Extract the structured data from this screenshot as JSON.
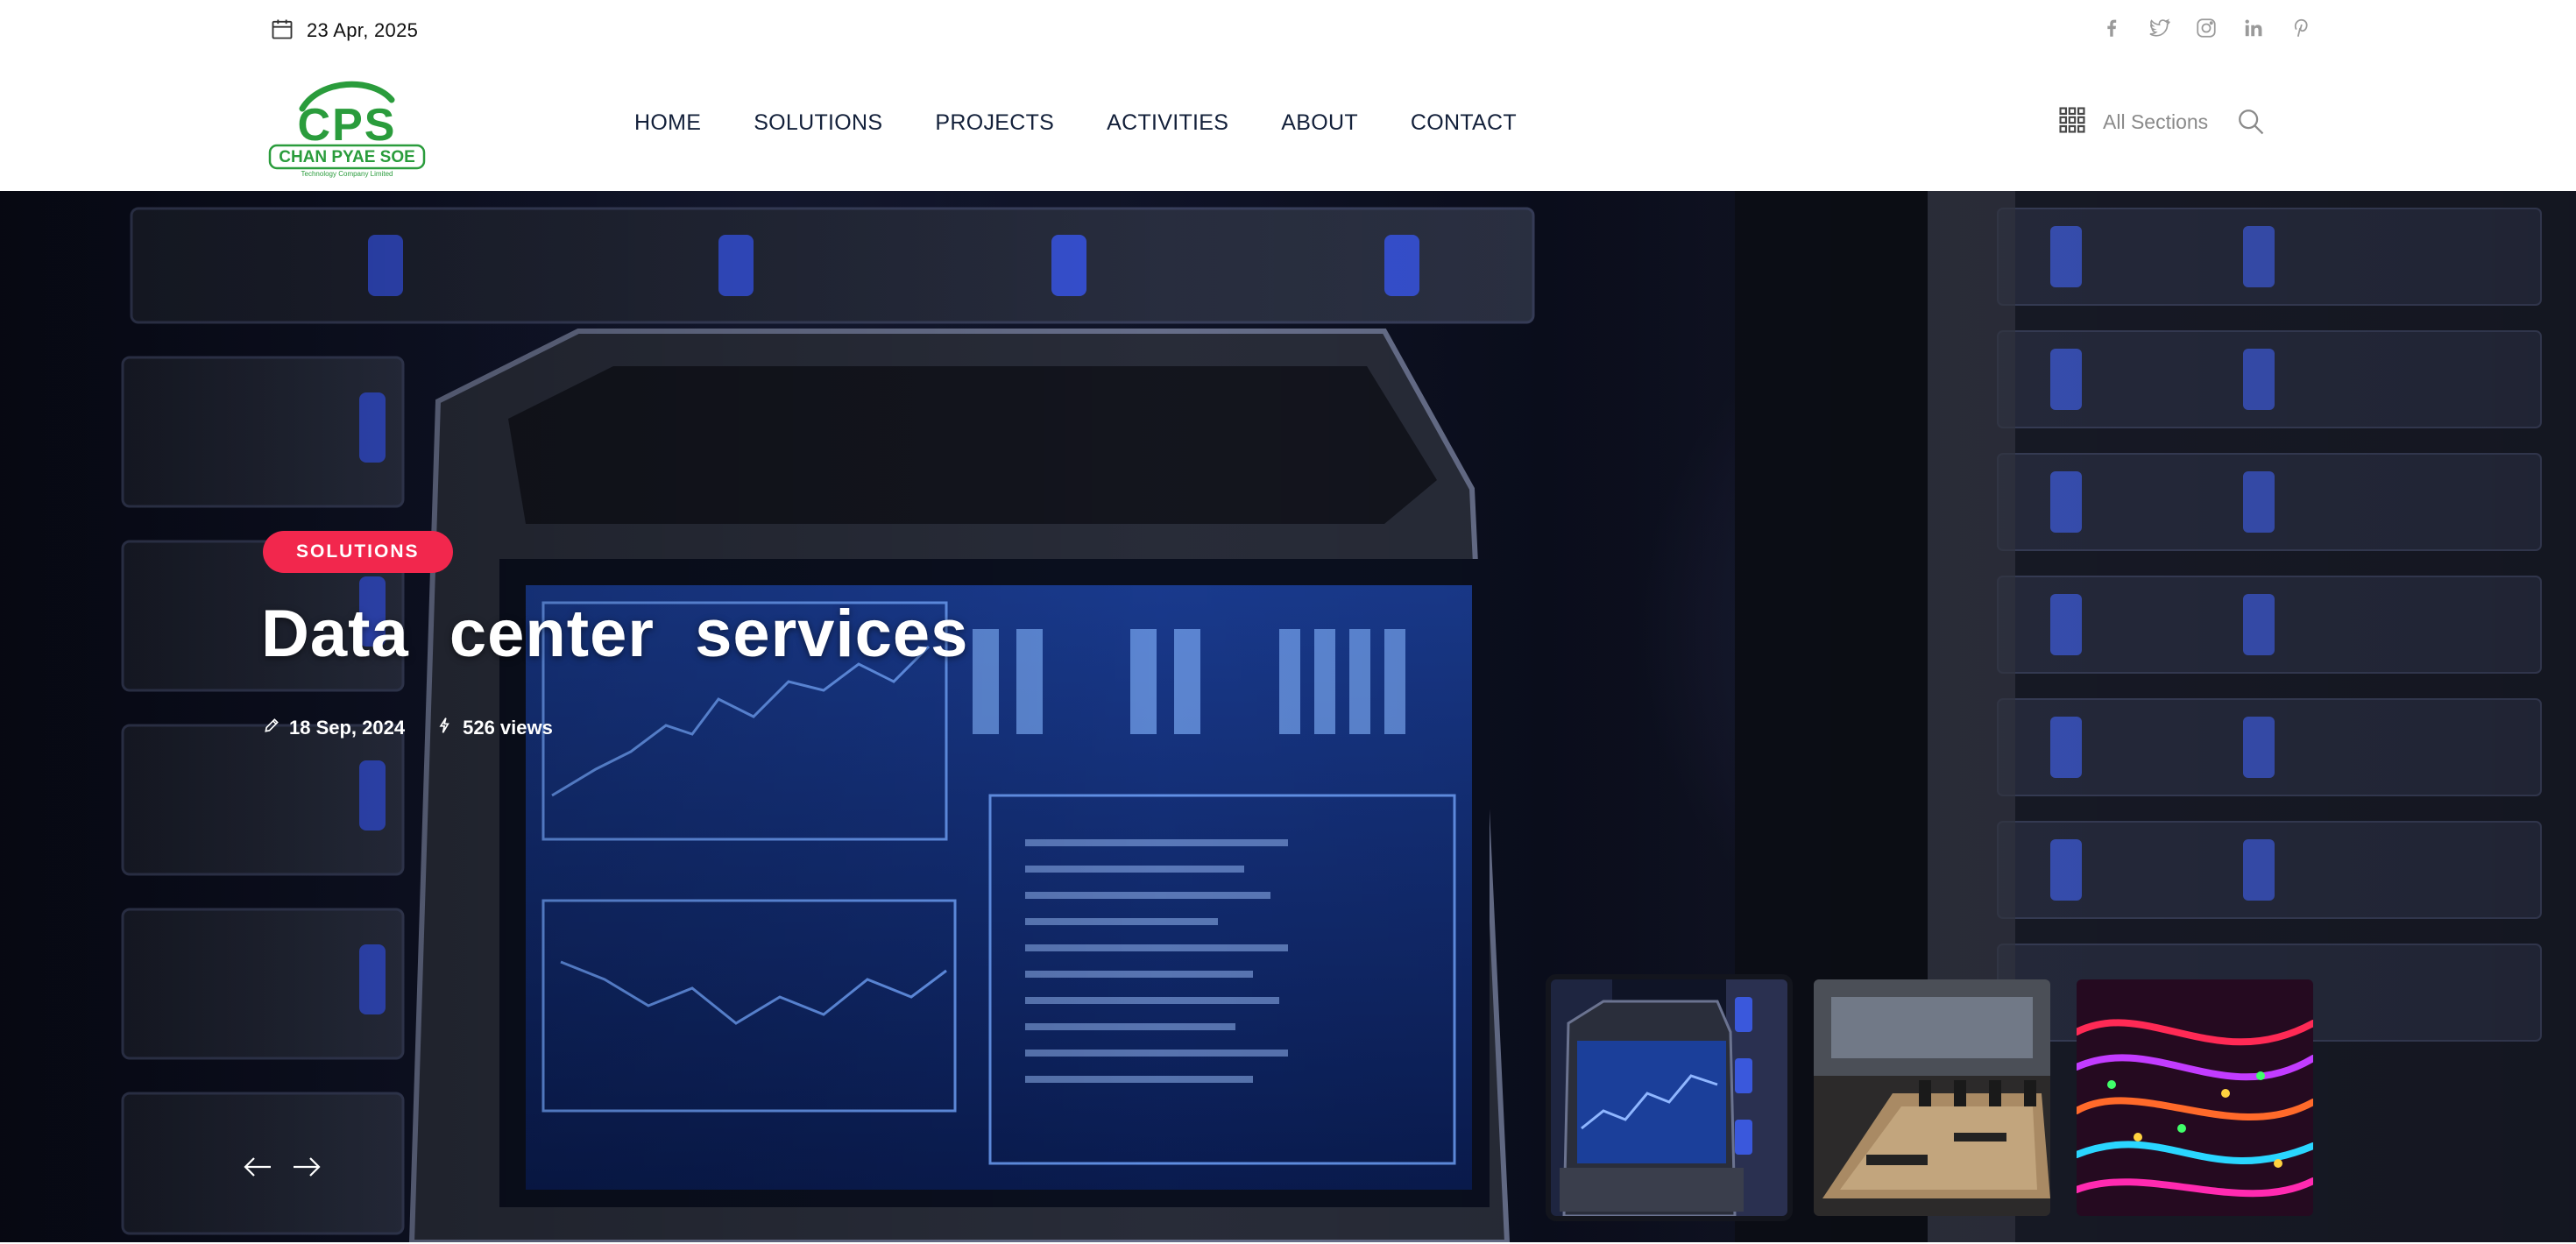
{
  "topbar": {
    "date": "23 Apr, 2025",
    "socials": [
      "facebook-icon",
      "twitter-icon",
      "instagram-icon",
      "linkedin-icon",
      "pinterest-icon"
    ]
  },
  "brand": {
    "logo_mark": "CPS",
    "logo_name": "CHAN PYAE SOE",
    "logo_tagline": "Technology Company Limited",
    "logo_color": "#2a9c3c"
  },
  "nav": {
    "items": [
      "HOME",
      "SOLUTIONS",
      "PROJECTS",
      "ACTIVITIES",
      "ABOUT",
      "CONTACT"
    ]
  },
  "header_tools": {
    "sections_label": "All Sections",
    "sections_icon": "grid-icon",
    "search_icon": "search-icon"
  },
  "hero": {
    "category": "SOLUTIONS",
    "title": "Data center services",
    "date": "18 Sep, 2024",
    "views": "526 views",
    "badge_color": "#f2274d",
    "thumbnails": [
      "server-laptop-thumbnail",
      "meeting-room-thumbnail",
      "network-cables-thumbnail"
    ],
    "active_thumbnail": 0
  }
}
